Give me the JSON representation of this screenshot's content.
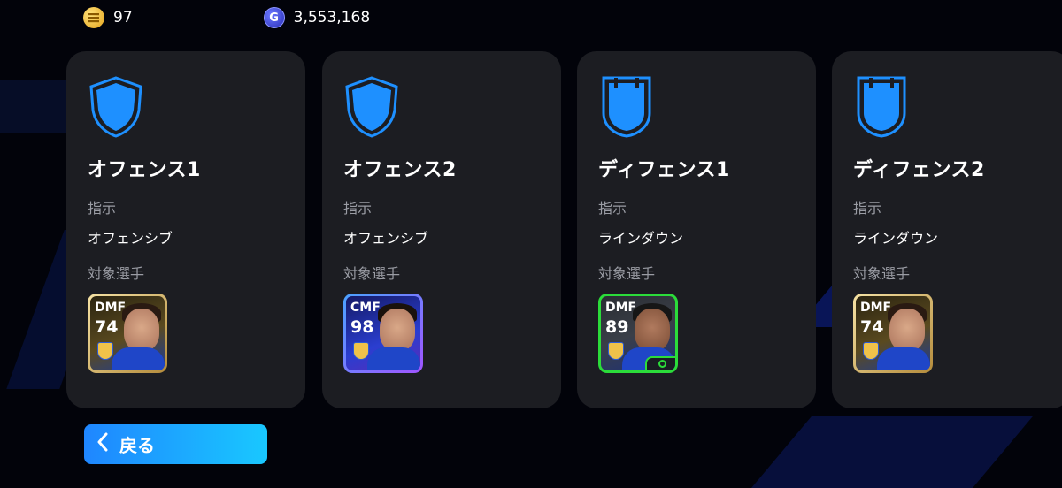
{
  "currency": {
    "coins": {
      "icon": "gold-coin-icon",
      "value": "97"
    },
    "gp": {
      "icon": "gp-coin-icon",
      "glyph": "G",
      "value": "3,553,168"
    }
  },
  "cards": [
    {
      "title": "オフェンス1",
      "instruction_label": "指示",
      "instruction_value": "オフェンシブ",
      "target_label": "対象選手",
      "player": {
        "position": "DMF",
        "rating": "74",
        "frame": "gold"
      }
    },
    {
      "title": "オフェンス2",
      "instruction_label": "指示",
      "instruction_value": "オフェンシブ",
      "target_label": "対象選手",
      "player": {
        "position": "CMF",
        "rating": "98",
        "frame": "purple"
      }
    },
    {
      "title": "ディフェンス1",
      "instruction_label": "指示",
      "instruction_value": "ラインダウン",
      "target_label": "対象選手",
      "player": {
        "position": "DMF",
        "rating": "89",
        "frame": "green"
      }
    },
    {
      "title": "ディフェンス2",
      "instruction_label": "指示",
      "instruction_value": "ラインダウン",
      "target_label": "対象選手",
      "player": {
        "position": "DMF",
        "rating": "74",
        "frame": "gold"
      }
    }
  ],
  "back_button": {
    "label": "戻る",
    "icon": "chevron-left-icon"
  },
  "colors": {
    "accent_blue": "#1f86ff",
    "accent_cyan": "#19c8ff",
    "card_bg": "#1c1d22",
    "shield_blue": "#1e90ff"
  }
}
